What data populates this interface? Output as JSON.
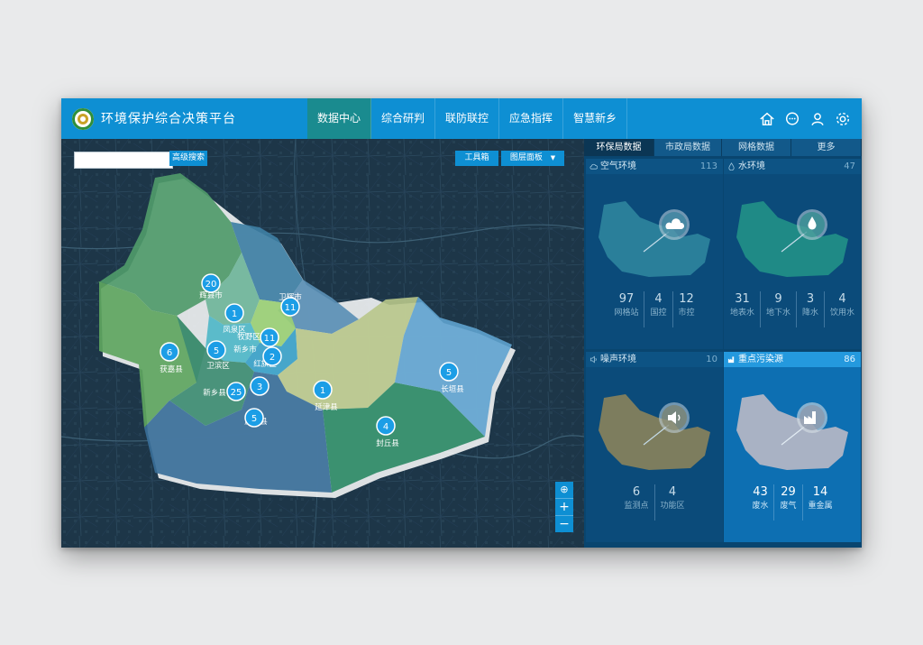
{
  "app": {
    "title": "环境保护综合决策平台"
  },
  "nav": [
    {
      "label": "数据中心",
      "active": true
    },
    {
      "label": "综合研判",
      "active": false
    },
    {
      "label": "联防联控",
      "active": false
    },
    {
      "label": "应急指挥",
      "active": false
    },
    {
      "label": "智慧新乡",
      "active": false
    }
  ],
  "top_icons": [
    "home-icon",
    "chat-icon",
    "user-icon",
    "gear-icon"
  ],
  "map": {
    "search_placeholder": "",
    "search_button": "高级搜索",
    "toolbox_button": "工具箱",
    "layers_button": "图层面板",
    "zoom_in": "+",
    "zoom_out": "−",
    "districts": [
      {
        "name": "辉县市",
        "count": "20"
      },
      {
        "name": "卫辉市",
        "count": "11"
      },
      {
        "name": "凤泉区",
        "count": "1"
      },
      {
        "name": "牧野区",
        "count": "11"
      },
      {
        "name": "新乡市",
        "count": "2"
      },
      {
        "name": "卫滨区",
        "count": "5"
      },
      {
        "name": "红旗区",
        "count": "3"
      },
      {
        "name": "获嘉县",
        "count": "6"
      },
      {
        "name": "新乡县",
        "count": "25"
      },
      {
        "name": "原阳县",
        "count": "5"
      },
      {
        "name": "延津县",
        "count": "1"
      },
      {
        "name": "封丘县",
        "count": "4"
      },
      {
        "name": "长垣县",
        "count": "5"
      }
    ]
  },
  "panel": {
    "tabs": [
      {
        "label": "环保局数据",
        "active": true
      },
      {
        "label": "市政局数据",
        "active": false
      },
      {
        "label": "网格数据",
        "active": false
      },
      {
        "label": "更多",
        "active": false
      }
    ],
    "cards": [
      {
        "title": "空气环境",
        "count": "113",
        "icon": "cloud-icon",
        "color": "#2a7f9a",
        "stats": [
          {
            "value": "97",
            "label": "网格站"
          },
          {
            "value": "4",
            "label": "国控"
          },
          {
            "value": "12",
            "label": "市控"
          }
        ]
      },
      {
        "title": "水环境",
        "count": "47",
        "icon": "water-drop-icon",
        "color": "#1f8a86",
        "stats": [
          {
            "value": "31",
            "label": "地表水"
          },
          {
            "value": "9",
            "label": "地下水"
          },
          {
            "value": "3",
            "label": "降水"
          },
          {
            "value": "4",
            "label": "饮用水"
          }
        ]
      },
      {
        "title": "噪声环境",
        "count": "10",
        "icon": "speaker-icon",
        "color": "#7d7d5e",
        "stats": [
          {
            "value": "6",
            "label": "监测点"
          },
          {
            "value": "4",
            "label": "功能区"
          }
        ]
      },
      {
        "title": "重点污染源",
        "count": "86",
        "icon": "factory-icon",
        "color": "#a9b2c4",
        "stats": [
          {
            "value": "43",
            "label": "废水"
          },
          {
            "value": "29",
            "label": "废气"
          },
          {
            "value": "14",
            "label": "重金属"
          }
        ]
      }
    ]
  },
  "colors": {
    "primary": "#0e8fd3",
    "active_nav": "#1a8b8f",
    "panel_bg": "#09456f",
    "marker": "#1c9ee6"
  }
}
